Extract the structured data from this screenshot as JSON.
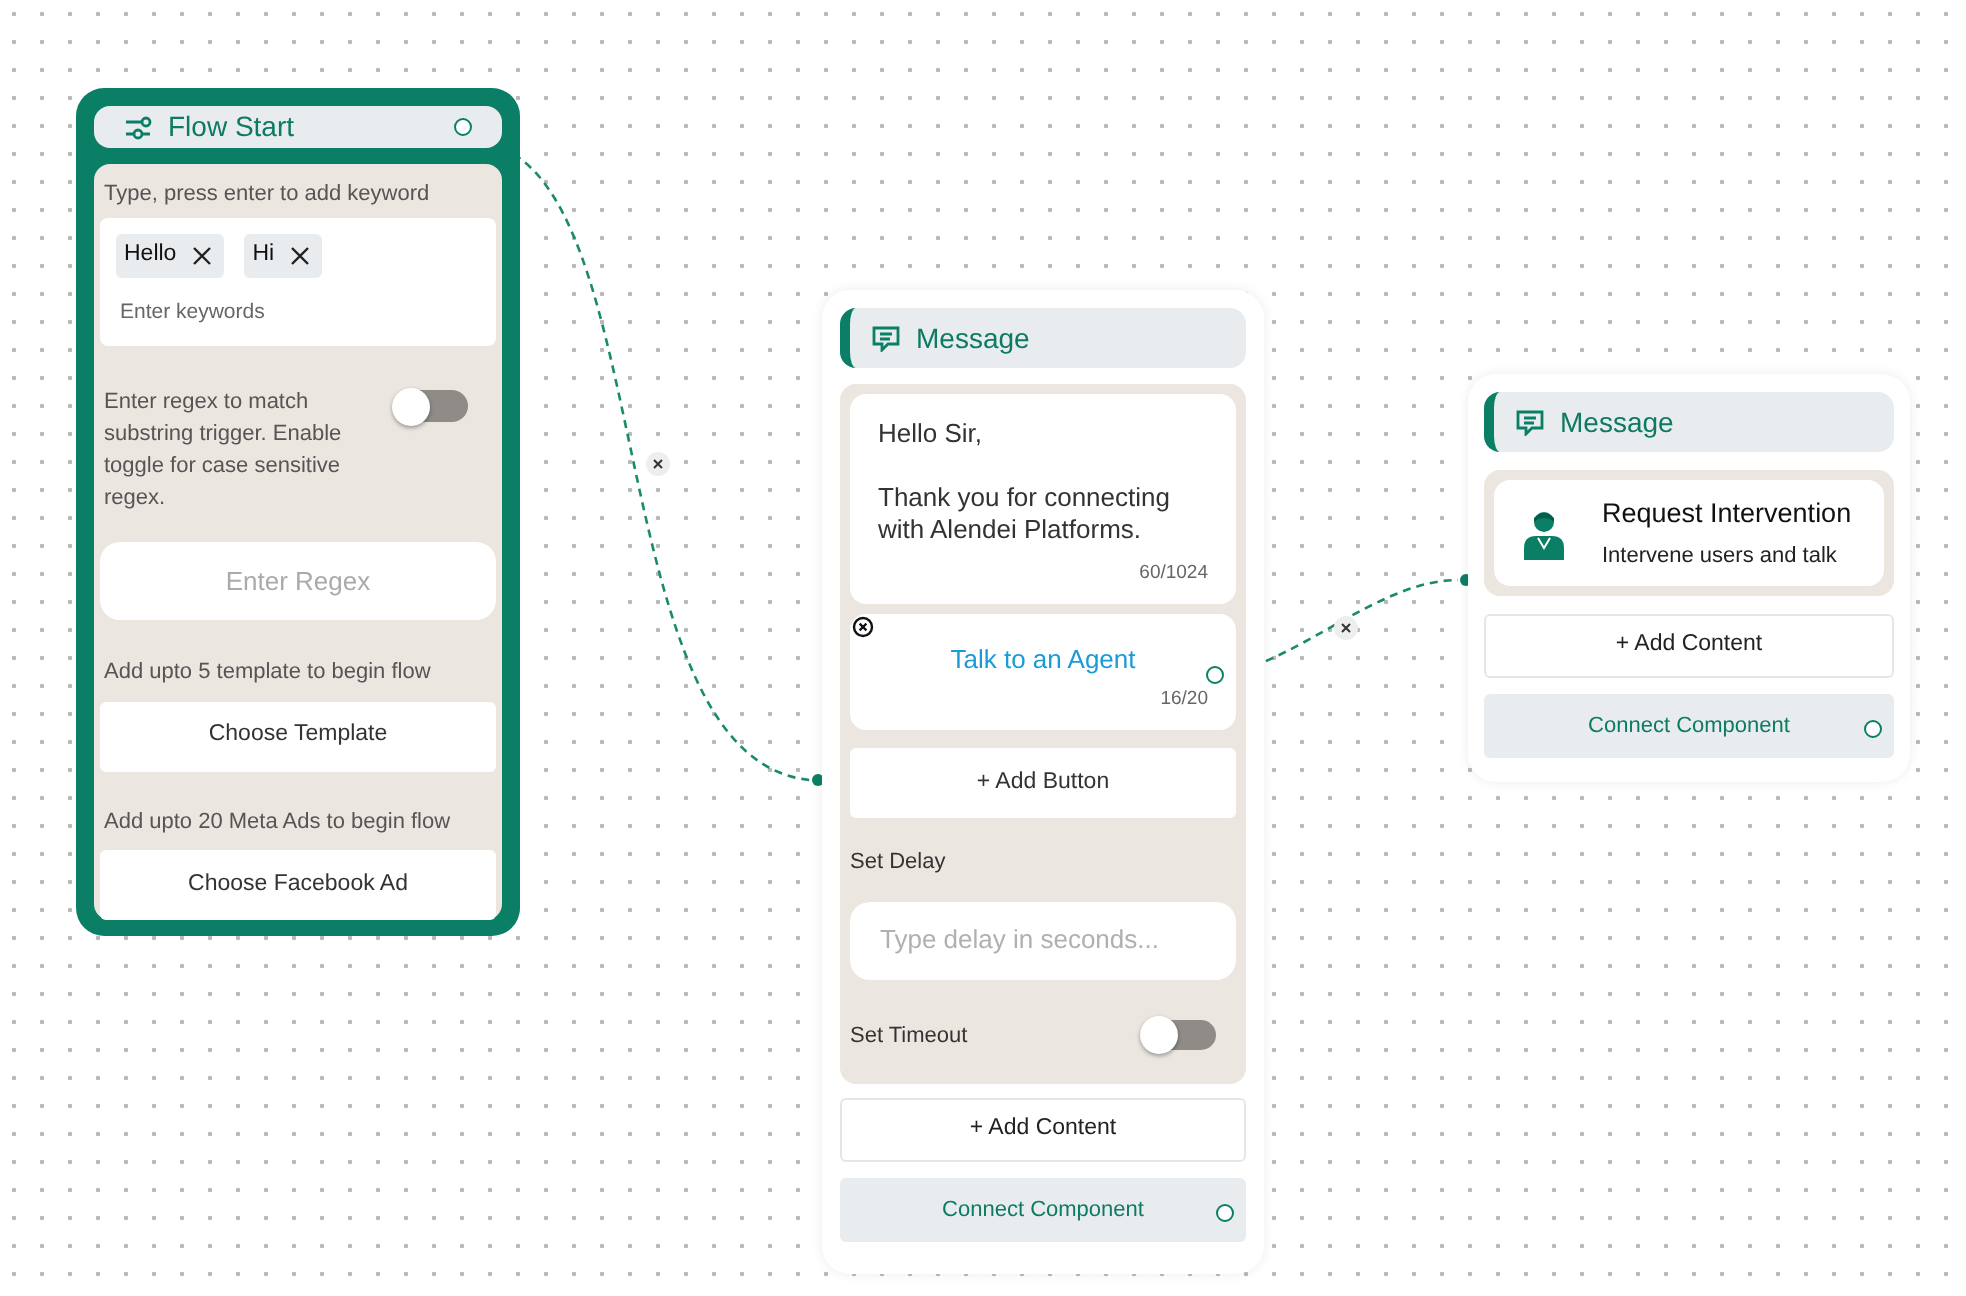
{
  "flow_start": {
    "title": "Flow Start",
    "keyword_label": "Type, press enter to add keyword",
    "keywords": [
      {
        "text": "Hello"
      },
      {
        "text": "Hi"
      }
    ],
    "keyword_placeholder": "Enter keywords",
    "regex_label": "Enter regex to match substring trigger. Enable toggle for case sensitive regex.",
    "regex_case_sensitive": {
      "on": false
    },
    "regex_placeholder": "Enter Regex",
    "template_label": "Add upto 5 template to begin flow",
    "template_button": "Choose Template",
    "ads_label": "Add upto 20 Meta Ads to begin flow",
    "ads_button": "Choose Facebook Ad"
  },
  "message_1": {
    "title": "Message",
    "text": "Hello Sir,\n\nThank you for connecting with Alendei Platforms.",
    "text_count": "60/1024",
    "buttons": [
      {
        "label": "Talk to an Agent",
        "count": "16/20"
      }
    ],
    "add_button": "+ Add Button",
    "delay_label": "Set Delay",
    "delay_placeholder": "Type delay in seconds...",
    "timeout_label": "Set Timeout",
    "timeout": {
      "on": false
    },
    "add_content": "+ Add Content",
    "connect": "Connect Component"
  },
  "message_2": {
    "title": "Message",
    "intervention": {
      "title": "Request Intervention",
      "subtitle": "Intervene users and talk"
    },
    "add_content": "+ Add Content",
    "connect": "Connect Component"
  }
}
